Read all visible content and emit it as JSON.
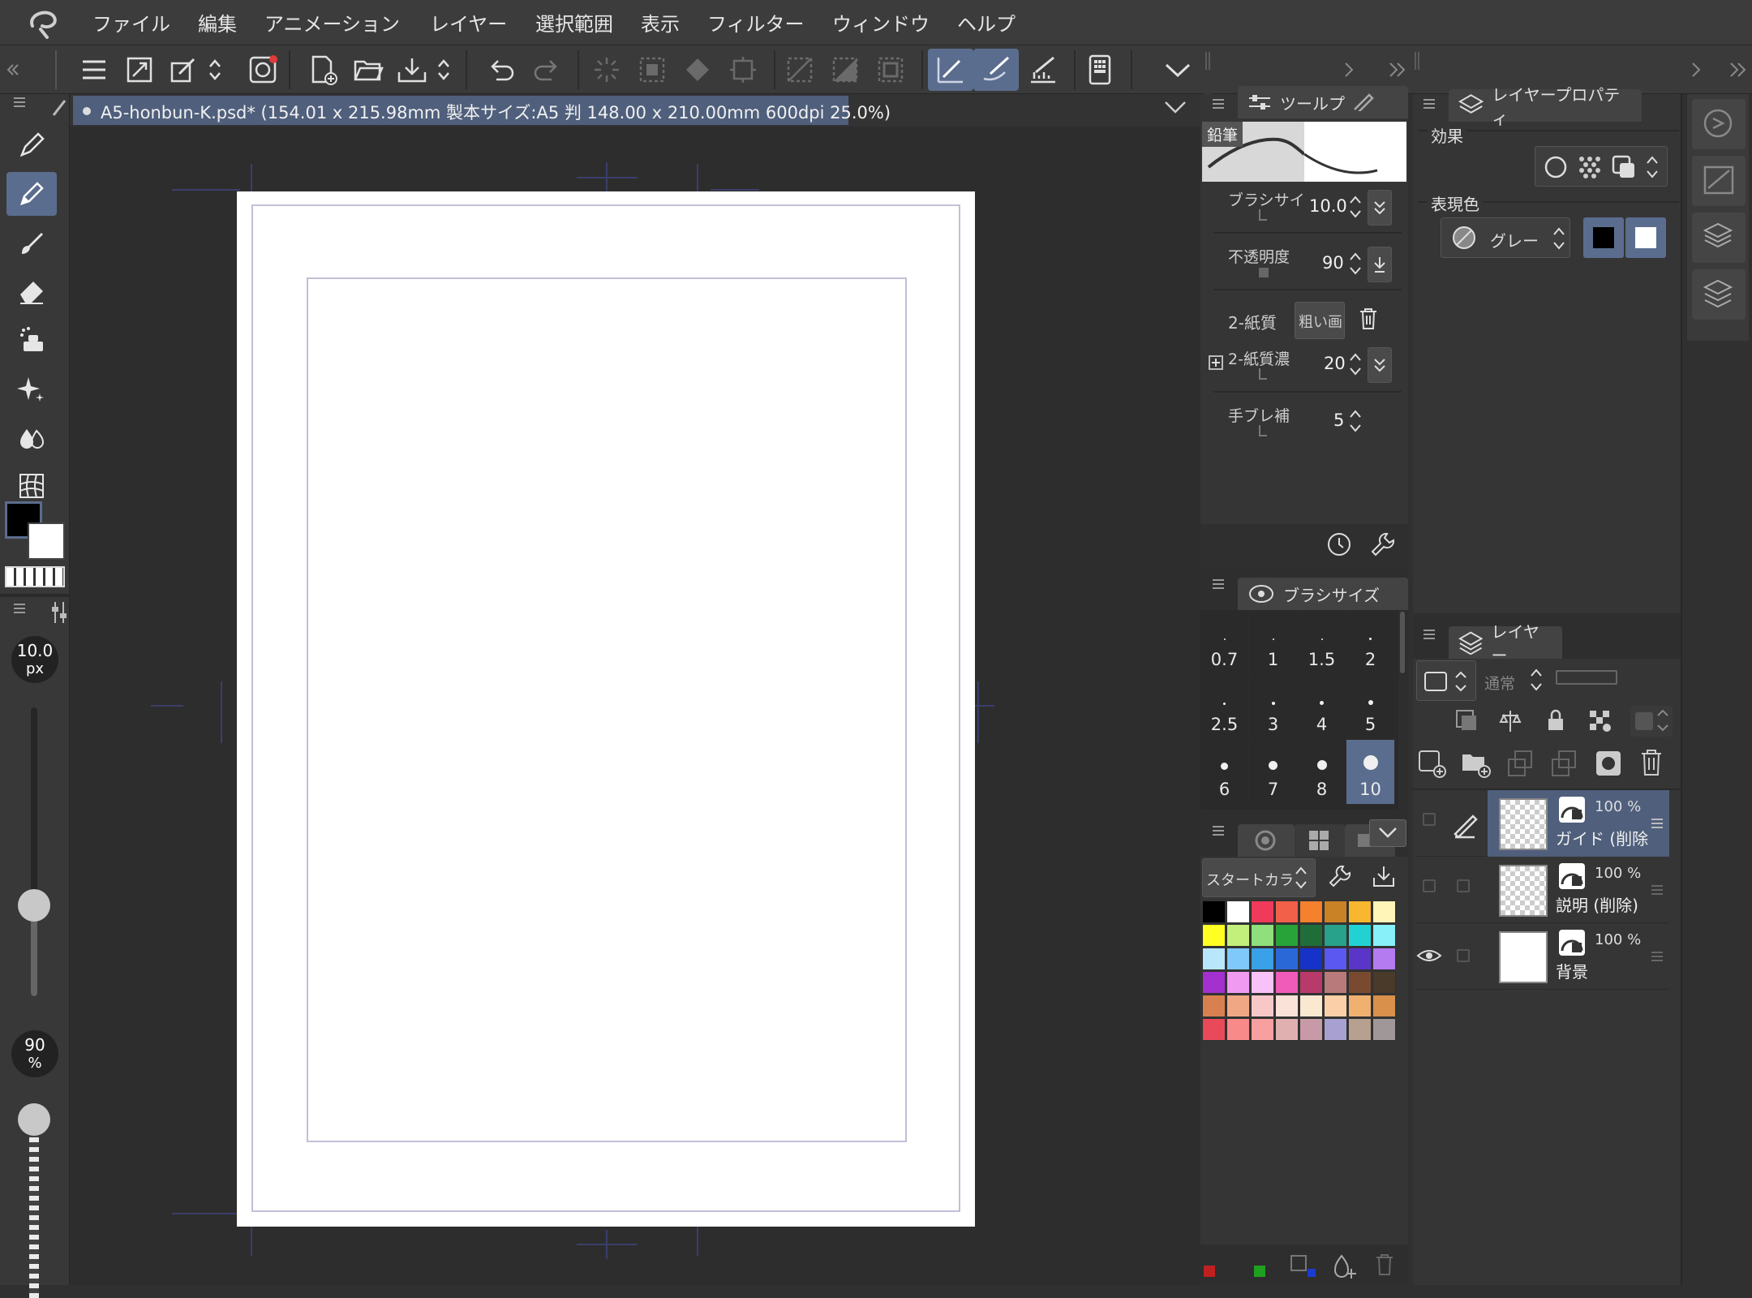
{
  "menu": [
    "ファイル",
    "編集",
    "アニメーション",
    "レイヤー",
    "選択範囲",
    "表示",
    "フィルター",
    "ウィンドウ",
    "ヘルプ"
  ],
  "document": {
    "title": "A5-honbun-K.psd* (154.01 x 215.98mm 製本サイズ:A5 判 148.00 x 210.00mm 600dpi 25.0%)"
  },
  "left_panel": {
    "brush_size_value": "10.0",
    "brush_size_unit": "px",
    "opacity_value": "90",
    "opacity_unit": "%"
  },
  "tool_property": {
    "tab_label": "ツールプ",
    "tool_name": "鉛筆",
    "brush_size_label": "ブラシサイ",
    "brush_size_value": "10.0",
    "opacity_label": "不透明度",
    "opacity_value": "90",
    "paper_label": "2-紙質",
    "paper_value": "粗い画",
    "paper_density_label": "2-紙質濃",
    "paper_density_value": "20",
    "stabilization_label": "手ブレ補",
    "stabilization_value": "5"
  },
  "brush_size_panel": {
    "tab_label": "ブラシサイズ",
    "sizes": [
      "0.7",
      "1",
      "1.5",
      "2",
      "2.5",
      "3",
      "4",
      "5",
      "6",
      "7",
      "8",
      "10"
    ],
    "selected": "10"
  },
  "color_set": {
    "set_name": "スタートカラ",
    "colors": [
      "#000000",
      "#ffffff",
      "#f03a5a",
      "#f2604a",
      "#f5802e",
      "#c98225",
      "#f8b72e",
      "#fff5b8",
      "#ffff22",
      "#c2f07a",
      "#8fdf7c",
      "#27a33a",
      "#1f6e3a",
      "#28a28a",
      "#22d2d2",
      "#88f0f8",
      "#b8e6fb",
      "#7fc8fa",
      "#3aa0e8",
      "#2a68d8",
      "#1632c8",
      "#5a58f0",
      "#5a36c8",
      "#b47af0",
      "#a430d0",
      "#f09af2",
      "#f8c2f8",
      "#f05ab8",
      "#b83a6a",
      "#b87a7a",
      "#7a4a30",
      "#4a3a2a",
      "#d88050",
      "#f0a884",
      "#f8c8c8",
      "#fbe2d8",
      "#fbe8d0",
      "#fbd0a8",
      "#f0b070",
      "#d8904a",
      "#e84a5a",
      "#f88a8a",
      "#f8a0a0",
      "#e0b0b0",
      "#c89aa8",
      "#a8a0d0",
      "#b8a090",
      "#a09898"
    ]
  },
  "layer_property": {
    "tab_label": "レイヤープロパティ",
    "effect_label": "効果",
    "expression_color_label": "表現色",
    "expression_color_value": "グレー"
  },
  "layer_panel": {
    "tab_label": "レイヤー",
    "blend_mode": "通常",
    "layers": [
      {
        "name": "ガイド (削除",
        "opacity": "100 %",
        "selected": true,
        "visible": false
      },
      {
        "name": "説明 (削除)",
        "opacity": "100 %",
        "selected": false,
        "visible": false
      },
      {
        "name": "背景",
        "opacity": "100 %",
        "selected": false,
        "visible": true
      }
    ]
  }
}
